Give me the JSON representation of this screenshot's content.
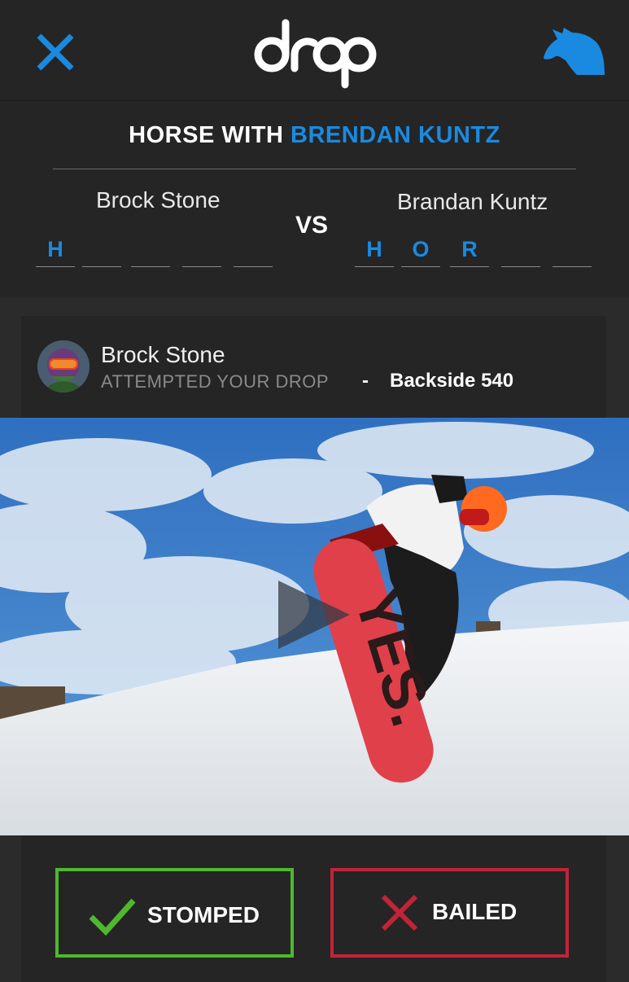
{
  "header": {
    "logo_text": "drop",
    "close_icon": "close-icon",
    "horse_icon": "horse-head-icon"
  },
  "game": {
    "title_prefix": "HORSE WITH ",
    "title_opponent": "BRENDAN KUNTZ",
    "vs_label": "VS",
    "player1": {
      "name": "Brock Stone",
      "letters": [
        "H",
        "",
        "",
        "",
        ""
      ]
    },
    "player2": {
      "name": "Brandan Kuntz",
      "letters": [
        "H",
        "O",
        "R",
        "",
        ""
      ]
    }
  },
  "attempt": {
    "name": "Brock Stone",
    "action": "ATTEMPTED YOUR DROP",
    "separator": "-",
    "trick": "Backside 540"
  },
  "video": {
    "board_text": "YES.",
    "play_icon": "play-icon"
  },
  "actions": {
    "stomped_label": "STOMPED",
    "bailed_label": "BAILED"
  },
  "colors": {
    "accent": "#1a8ae0",
    "stomped": "#4fb82e",
    "bailed": "#c0243a",
    "background": "#2b2b2b",
    "panel": "#252525"
  }
}
